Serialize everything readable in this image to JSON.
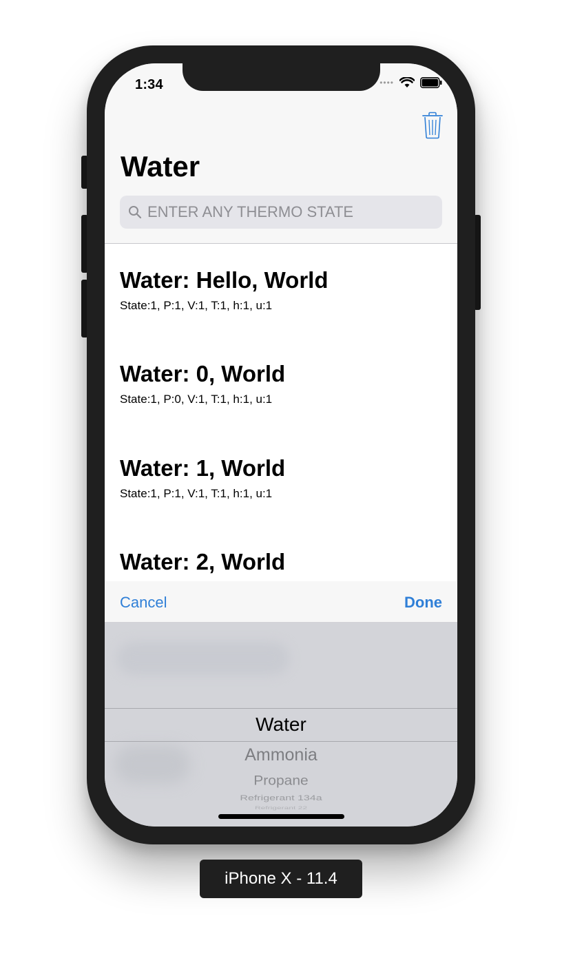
{
  "status_bar": {
    "time": "1:34"
  },
  "nav": {
    "title": "Water",
    "search_placeholder": "ENTER ANY THERMO STATE",
    "accent_color": "#2f7fd7"
  },
  "list": {
    "rows": [
      {
        "title": "Water: Hello, World",
        "subtitle": "State:1, P:1, V:1, T:1, h:1, u:1"
      },
      {
        "title": "Water: 0, World",
        "subtitle": "State:1, P:0, V:1, T:1, h:1, u:1"
      },
      {
        "title": "Water: 1, World",
        "subtitle": "State:1, P:1, V:1, T:1, h:1, u:1"
      },
      {
        "title": "Water: 2, World",
        "subtitle": ""
      }
    ]
  },
  "picker_toolbar": {
    "cancel_label": "Cancel",
    "done_label": "Done"
  },
  "picker": {
    "selected": "Water",
    "options_below": [
      "Ammonia",
      "Propane",
      "Refrigerant 134a",
      "Refrigerant 22"
    ]
  },
  "device_label": "iPhone X - 11.4"
}
